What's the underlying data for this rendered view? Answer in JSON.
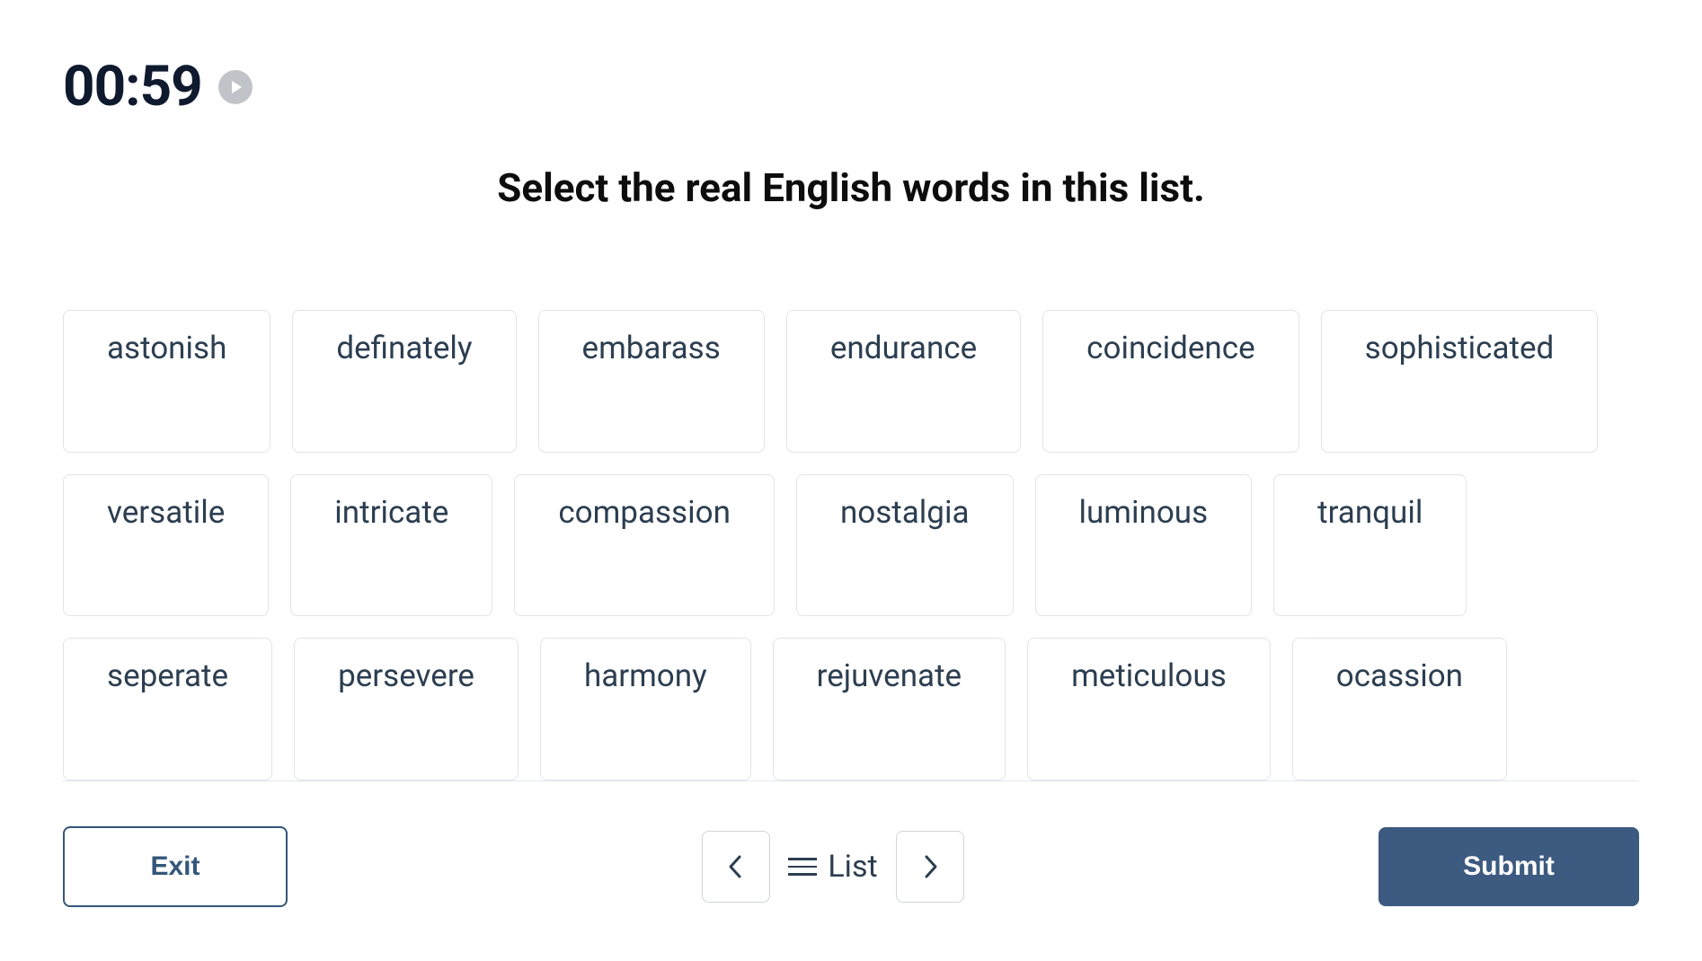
{
  "timer": "00:59",
  "prompt": "Select the real English words in this list.",
  "words": [
    "astonish",
    "definately",
    "embarass",
    "endurance",
    "coincidence",
    "sophisticated",
    "versatile",
    "intricate",
    "compassion",
    "nostalgia",
    "luminous",
    "tranquil",
    "seperate",
    "persevere",
    "harmony",
    "rejuvenate",
    "meticulous",
    "ocassion"
  ],
  "footer": {
    "exit_label": "Exit",
    "list_label": "List",
    "submit_label": "Submit"
  }
}
